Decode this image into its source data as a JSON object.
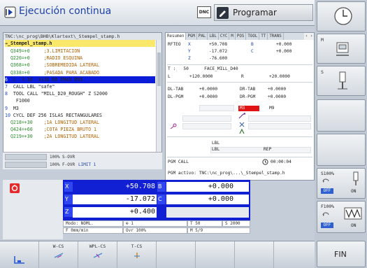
{
  "header": {
    "mode_title": "Ejecución continua",
    "dnc_label": "DNC",
    "program_label": "Programar"
  },
  "program": {
    "path": "TNC:\\nc_prog\\BHB\\Klartext\\_Stempel_stamp.h",
    "filename": "→_Stempel_stamp.h",
    "lines": [
      {
        "num": "",
        "text": "  Q349=+0     ;3.LIMITACION"
      },
      {
        "num": "",
        "text": "  Q220=+0     ;RADIO ESQUINA"
      },
      {
        "num": "",
        "text": "  Q368=+0     ;SOBREMEDIDA LATERAL"
      },
      {
        "num": "",
        "text": "  Q338=+0     ;PASADA PARA ACABADO"
      },
      {
        "num": "6",
        "text": "  L  Y-30  X+30 R0 FMAX M99"
      },
      {
        "num": "7",
        "text": "  CALL LBL \"safe\""
      },
      {
        "num": "8",
        "text": "  TOOL CALL \"MILL_D20_ROUGH\" Z S2000"
      },
      {
        "num": "",
        "text": "    F1000"
      },
      {
        "num": "9",
        "text": "  M3"
      },
      {
        "num": "10",
        "text": " CYCL DEF 256 ISLAS RECTANGULARES"
      },
      {
        "num": "",
        "text": "  Q218=+30    ;1A LONGITUD LATERAL"
      },
      {
        "num": "",
        "text": "  Q424=+60    ;COTA PIEZA BRUTO 1"
      },
      {
        "num": "",
        "text": "  Q219=+30    ;2A LONGITUD LATERAL"
      }
    ]
  },
  "overrides": {
    "spindle": "100% S-OVR",
    "feed": "100% F-OVR",
    "limit": "LIMIT 1"
  },
  "status_tabs": [
    "Resumen",
    "PGM",
    "PAL",
    "LBL",
    "CYC",
    "M",
    "POS",
    "TOOL",
    "TT",
    "TRANS"
  ],
  "status": {
    "rfteo": "RFTEO",
    "x_label": "X",
    "x_val": "+50.708",
    "y_label": "Y",
    "y_val": "-17.072",
    "z_label": "Z",
    "z_val": "-76.600",
    "b_label": "B",
    "b_val": "+0.000",
    "c_label": "C",
    "c_val": "+0.000",
    "tool_row": "T :   50      FACE_MILL_D40",
    "l_label": "L",
    "l_val": "+120.0000",
    "r_label": "R",
    "r_val": "+20.0000",
    "dltab": "DL-TAB",
    "dltab_val": "+0.0000",
    "drtab": "DR-TAB",
    "drtab_val": "+0.0000",
    "dlpgm": "DL-PGM",
    "dlpgm_val": "+0.0000",
    "drpgm": "DR-PGM",
    "drpgm_val": "+0.0000",
    "m3": "M3",
    "m9": "M9",
    "lbl1": "LBL",
    "lbl2": "LBL",
    "rep": "REP",
    "pgmcall": "PGM CALL",
    "time": "00:00:04",
    "pgm_active": "PGM activo: TNC:\\nc_prog\\...\\_Stempel_stamp.h"
  },
  "positions": {
    "x_label": "X",
    "x_val": "+50.708",
    "b_label": "B",
    "b_val": "+0.000",
    "y_label": "Y",
    "y_val": "-17.072",
    "c_label": "C",
    "c_val": "+0.000",
    "z_label": "Z",
    "z_val": "+0.400"
  },
  "modes": {
    "modo": "Modo: NOML.",
    "tool": "T 50",
    "spindle": "S 2000",
    "feed": "F 0mm/min",
    "ovr": "Ovr 100%",
    "m": "M 5/9",
    "reference": "1"
  },
  "softkeys": [
    "",
    "W-CS",
    "WPL-CS",
    "T-CS",
    "",
    "",
    "",
    ""
  ],
  "sidebar": {
    "s_label": "S",
    "m_label": "M",
    "s100": "S100%",
    "f100": "F100%",
    "off1": "OFF",
    "on1": "ON",
    "off2": "OFF",
    "on2": "ON",
    "fin": "FIN"
  },
  "colors": {
    "accent_blue": "#1020d2",
    "highlight_line": "#0a1cd8",
    "file_bar": "#f9e86a",
    "alarm_red": "#e01414"
  }
}
